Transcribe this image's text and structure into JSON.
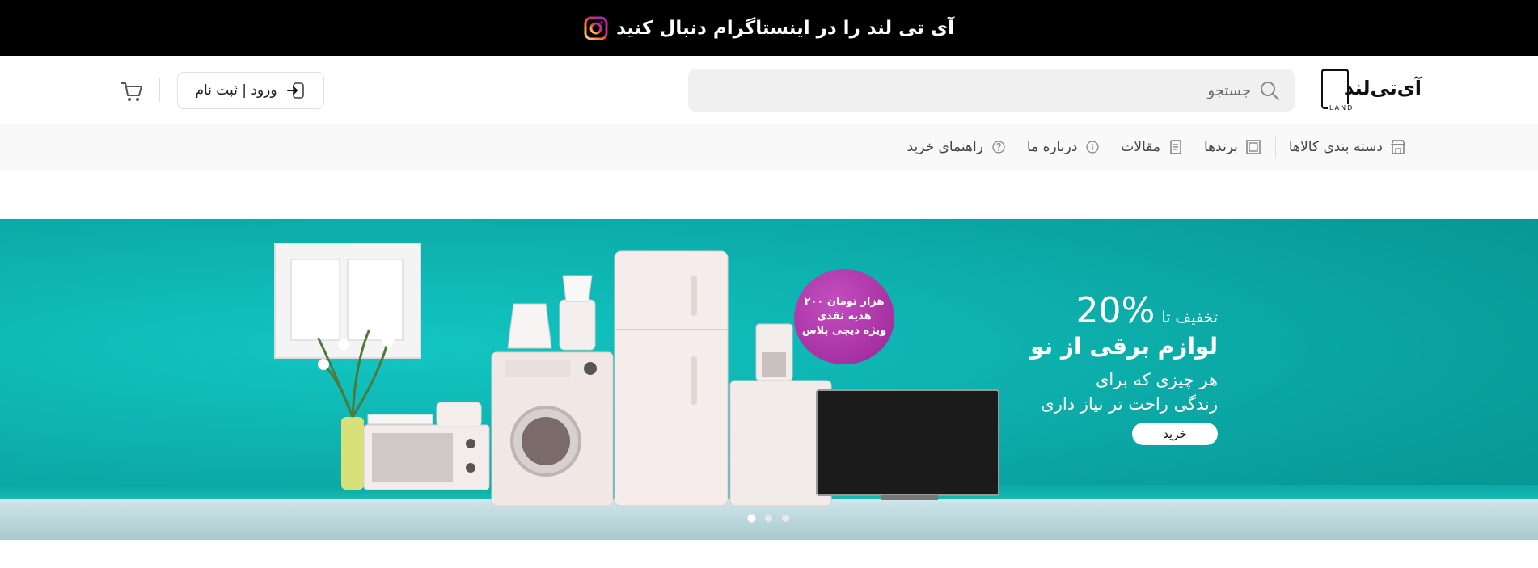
{
  "topbar": {
    "text": "آی تی لند را در اینستاگرام دنبال کنید",
    "icon": "instagram-icon"
  },
  "header": {
    "logo_text": "آی‌تی‌لند",
    "logo_sub": "LAND",
    "search_placeholder": "جستجو",
    "login_label": "ورود | ثبت نام",
    "cart_icon": "cart-icon"
  },
  "nav": {
    "items": [
      {
        "label": "دسته بندی کالاها",
        "icon": "store-icon"
      },
      {
        "label": "برندها",
        "icon": "brand-icon"
      },
      {
        "label": "مقالات",
        "icon": "document-icon"
      },
      {
        "label": "درباره ما",
        "icon": "info-icon"
      },
      {
        "label": "راهنمای خرید",
        "icon": "help-icon"
      }
    ]
  },
  "banner": {
    "discount_label": "تخفیف تا",
    "discount_value": "20%",
    "title": "لوازم برقی از نو",
    "sub_line1": "هر چیزی که برای",
    "sub_line2": "زندگی راحت تر نیاز داری",
    "buy_label": "خرید",
    "badge_line1": "۲۰۰ هزار تومان",
    "badge_line2": "هدیه نقدی",
    "badge_line3": "ویژه دیجی پلاس",
    "slides": 3,
    "active_slide": 1
  },
  "colors": {
    "banner": "#0eb3b0",
    "badge": "#a12c9c",
    "topbar": "#000000"
  }
}
